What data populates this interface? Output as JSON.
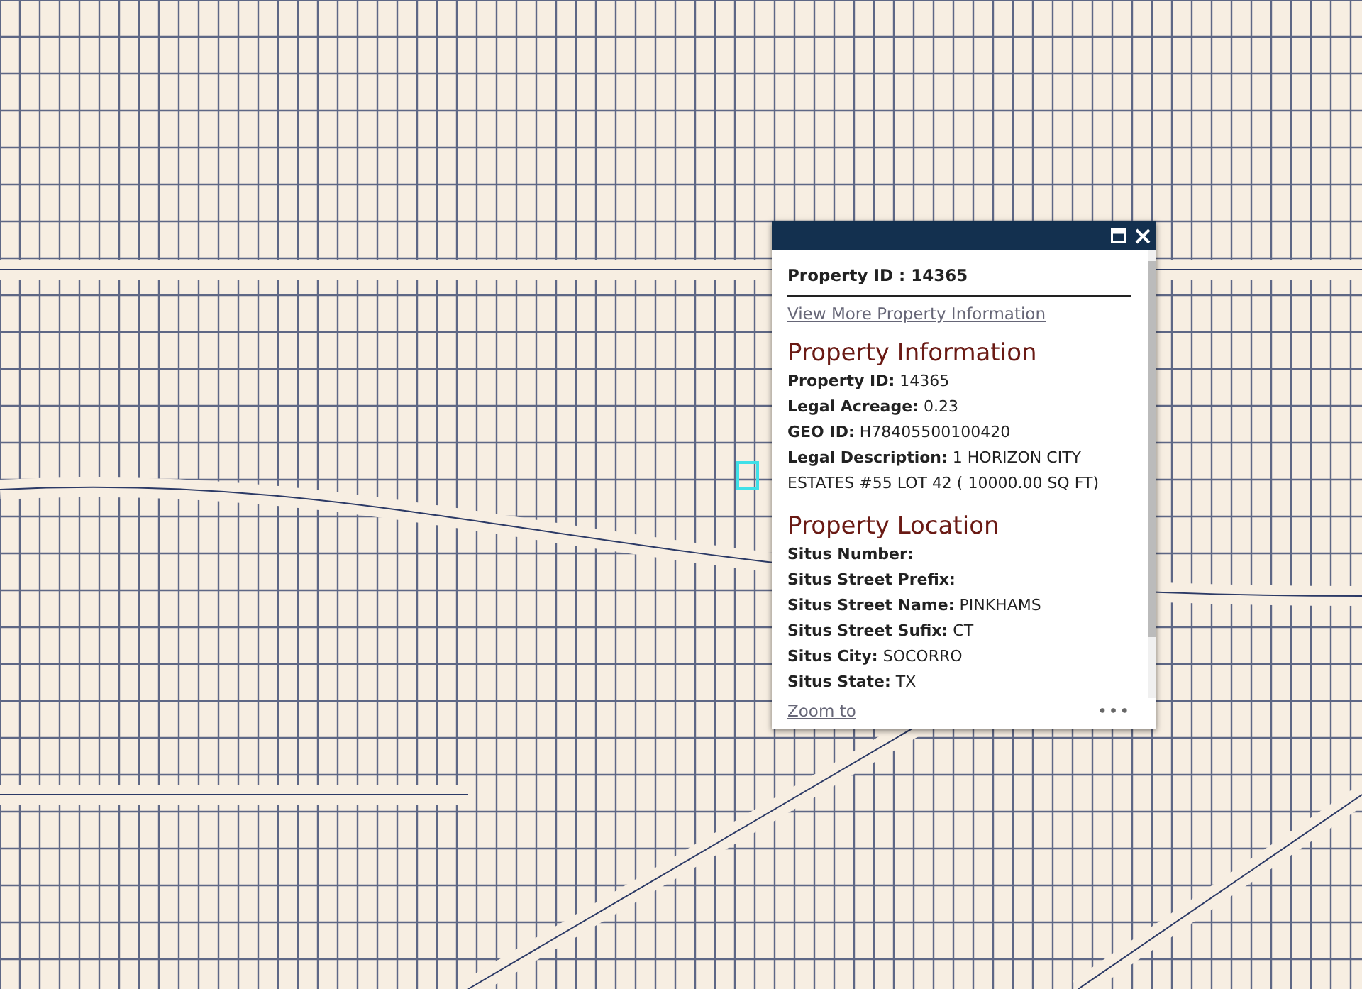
{
  "popup": {
    "title": "Property ID : 14365",
    "link": "View More Property Information",
    "sections": [
      {
        "heading": "Property Information",
        "rows": [
          "**Property ID:** 14365",
          "**Legal Acreage:** 0.23",
          "**GEO ID:** H78405500100420",
          "**Legal Description:** 1 HORIZON CITY ESTATES #55 LOT 42 ( 10000.00 SQ FT)"
        ]
      },
      {
        "heading": "Property Location",
        "rows": [
          "**Situs Number:**",
          "**Situs Street Prefix:**",
          "**Situs Street Name:** PINKHAMS",
          "**Situs Street Sufix:** CT",
          "**Situs City:** SOCORRO",
          "**Situs State:** TX"
        ]
      }
    ],
    "footer_link": "Zoom to",
    "more": "•••"
  }
}
